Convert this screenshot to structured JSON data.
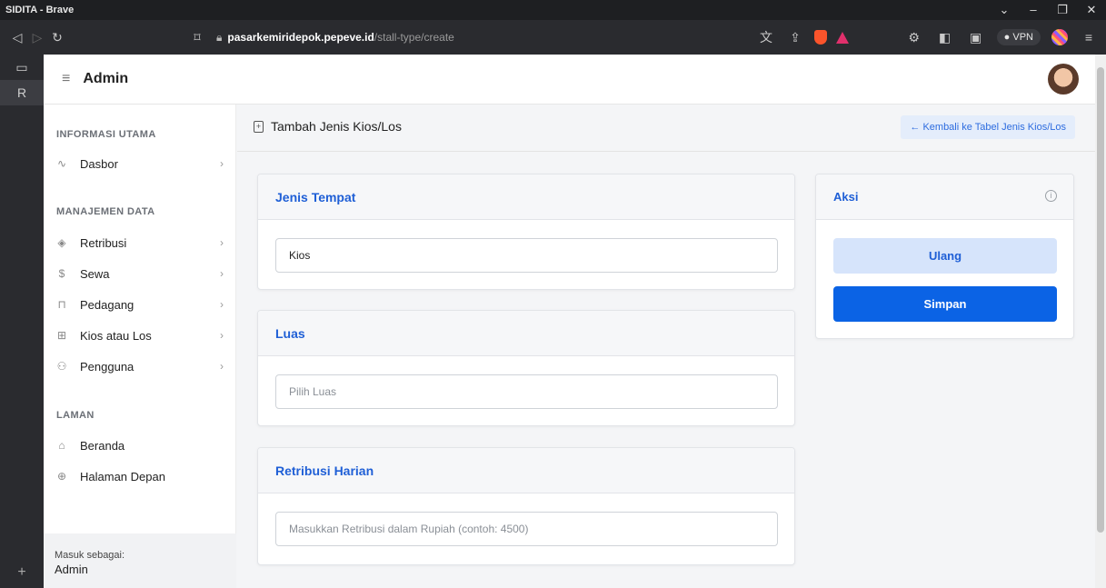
{
  "browser": {
    "window_title": "SIDITA - Brave",
    "url_host": "pasarkemiridepok.pepeve.id",
    "url_path": "/stall-type/create",
    "vpn_label": "VPN",
    "accent_color": "#fb542b"
  },
  "app": {
    "header_title": "Admin",
    "page_title": "Tambah Jenis Kios/Los",
    "back_button": "← Kembali ke Tabel Jenis Kios/Los",
    "accent_color": "#0b63e5"
  },
  "sidebar": {
    "section_main": "INFORMASI UTAMA",
    "section_data": "MANAJEMEN DATA",
    "section_pages": "LAMAN",
    "items": [
      {
        "label": "Dasbor",
        "icon": "activity-icon"
      },
      {
        "label": "Retribusi",
        "icon": "box-icon"
      },
      {
        "label": "Sewa",
        "icon": "dollar-icon"
      },
      {
        "label": "Pedagang",
        "icon": "store-icon"
      },
      {
        "label": "Kios atau Los",
        "icon": "map-icon"
      },
      {
        "label": "Pengguna",
        "icon": "users-icon"
      },
      {
        "label": "Beranda",
        "icon": "home-icon"
      },
      {
        "label": "Halaman Depan",
        "icon": "globe-icon"
      }
    ],
    "login_label": "Masuk sebagai:",
    "login_user": "Admin"
  },
  "form": {
    "jenis_title": "Jenis Tempat",
    "jenis_value": "Kios",
    "luas_title": "Luas",
    "luas_placeholder": "Pilih Luas",
    "retribusi_title": "Retribusi Harian",
    "retribusi_placeholder": "Masukkan Retribusi dalam Rupiah (contoh: 4500)"
  },
  "actions": {
    "title": "Aksi",
    "reset_label": "Ulang",
    "save_label": "Simpan"
  }
}
